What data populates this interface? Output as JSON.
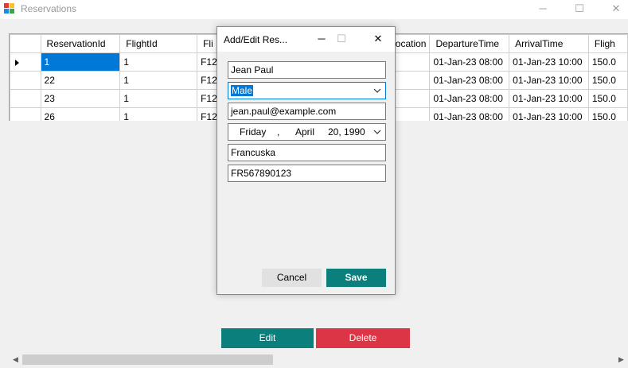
{
  "window": {
    "title": "Reservations",
    "minimize": "─",
    "maximize": "☐",
    "close": "✕"
  },
  "grid": {
    "columns": [
      "ReservationId",
      "FlightId",
      "Fli",
      "",
      "",
      "ocation",
      "DepartureTime",
      "ArrivalTime",
      "Fligh"
    ],
    "rows": [
      {
        "cells": [
          "1",
          "1",
          "F12",
          "",
          "",
          "",
          "01-Jan-23 08:00",
          "01-Jan-23 10:00",
          "150.0"
        ]
      },
      {
        "cells": [
          "22",
          "1",
          "F12",
          "",
          "",
          "",
          "01-Jan-23 08:00",
          "01-Jan-23 10:00",
          "150.0"
        ]
      },
      {
        "cells": [
          "23",
          "1",
          "F12",
          "",
          "",
          "",
          "01-Jan-23 08:00",
          "01-Jan-23 10:00",
          "150.0"
        ]
      },
      {
        "cells": [
          "26",
          "1",
          "F12",
          "",
          "",
          "",
          "01-Jan-23 08:00",
          "01-Jan-23 10:00",
          "150.0"
        ]
      }
    ]
  },
  "buttons": {
    "edit": "Edit",
    "delete": "Delete"
  },
  "dialog": {
    "title": "Add/Edit Res...",
    "minimize": "─",
    "maximize": "☐",
    "close": "✕",
    "name": "Jean Paul",
    "gender": "Male",
    "email": "jean.paul@example.com",
    "dob_day": "Friday",
    "dob_sep": ",",
    "dob_month": "April",
    "dob_date": "20, 1990",
    "country": "Francuska",
    "passport": "FR567890123",
    "cancel": "Cancel",
    "save": "Save"
  },
  "colors": {
    "accent": "#0a7f7b",
    "danger": "#dc3545",
    "selection": "#0078d7"
  }
}
